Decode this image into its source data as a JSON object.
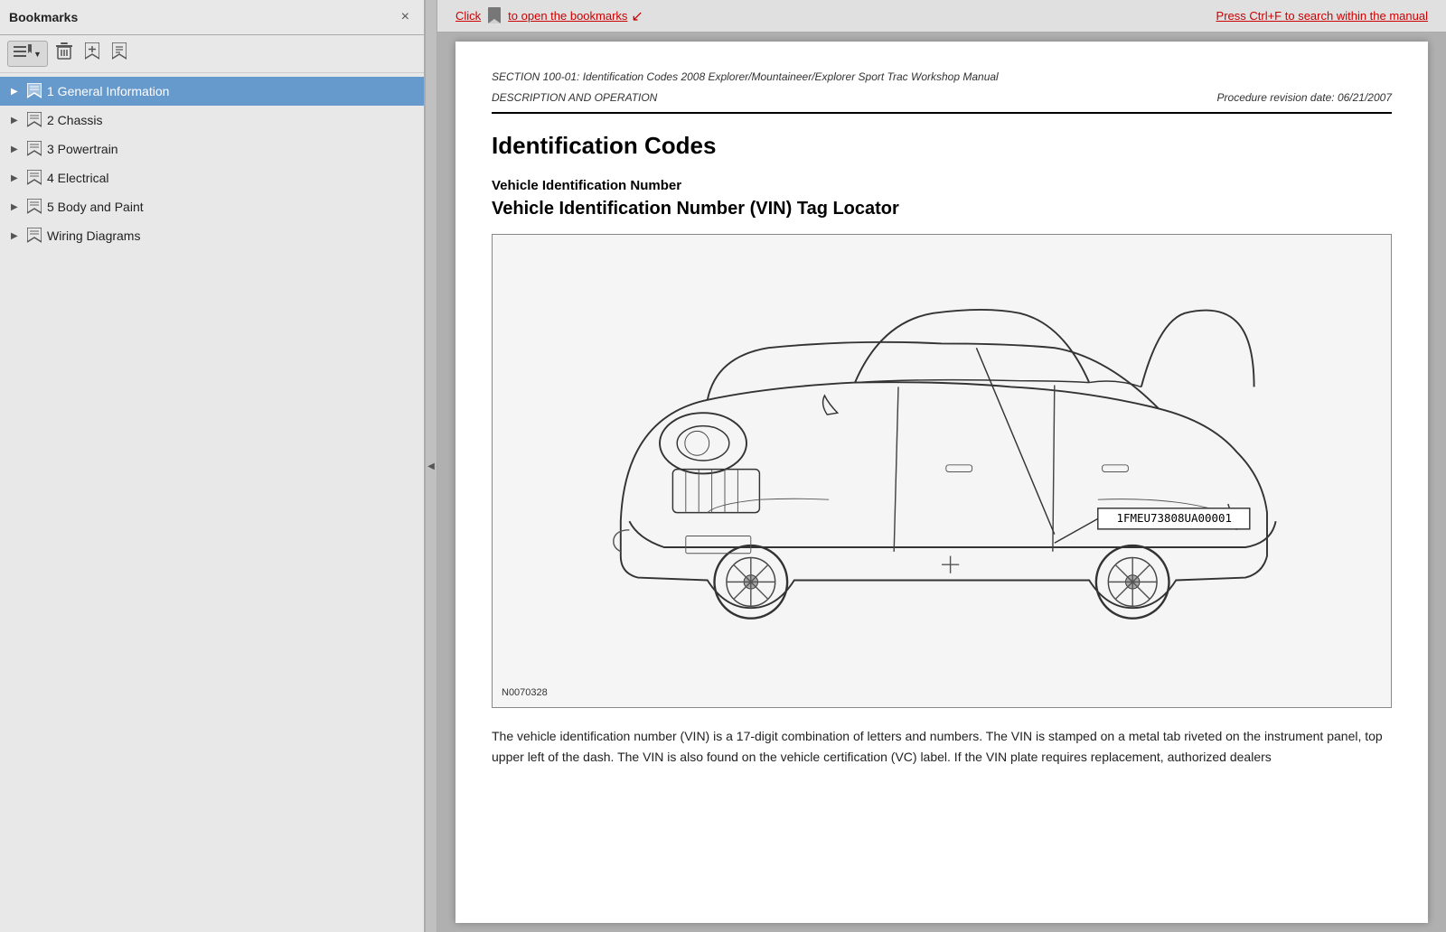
{
  "sidebar": {
    "title": "Bookmarks",
    "close_label": "×",
    "toolbar": {
      "dropdown_btn": "📋",
      "delete_btn": "🗑",
      "bookmark_btn": "🔖",
      "bookmark2_btn": "🏷"
    },
    "items": [
      {
        "id": "item-1",
        "label": "1 General Information",
        "active": true,
        "expanded": false
      },
      {
        "id": "item-2",
        "label": "2 Chassis",
        "active": false,
        "expanded": false
      },
      {
        "id": "item-3",
        "label": "3 Powertrain",
        "active": false,
        "expanded": false
      },
      {
        "id": "item-4",
        "label": "4 Electrical",
        "active": false,
        "expanded": false
      },
      {
        "id": "item-5",
        "label": "5 Body and Paint",
        "active": false,
        "expanded": false
      },
      {
        "id": "item-6",
        "label": "Wiring Diagrams",
        "active": false,
        "expanded": false
      }
    ]
  },
  "topbar": {
    "hint_open": "Click",
    "hint_open2": "to open the bookmarks",
    "hint_search": "Press Ctrl+F to search within the manual",
    "hint_arrow": "↙"
  },
  "page": {
    "section_line1": "SECTION 100-01: Identification Codes   2008 Explorer/Mountaineer/Explorer Sport Trac Workshop Manual",
    "section_line2": "DESCRIPTION AND OPERATION",
    "section_rev": "Procedure revision date: 06/21/2007",
    "main_heading": "Identification Codes",
    "sub_heading1": "Vehicle Identification Number",
    "sub_heading2": "Vehicle Identification Number (VIN) Tag Locator",
    "vin_number": "1FMEU73808UA00001",
    "diagram_caption": "N0070328",
    "body_text": "The vehicle identification number (VIN) is a 17-digit combination of letters and numbers. The VIN is stamped on a metal tab riveted on the instrument panel, top upper left of the dash. The VIN is also found on the vehicle certification (VC) label. If the VIN plate requires replacement, authorized dealers"
  }
}
